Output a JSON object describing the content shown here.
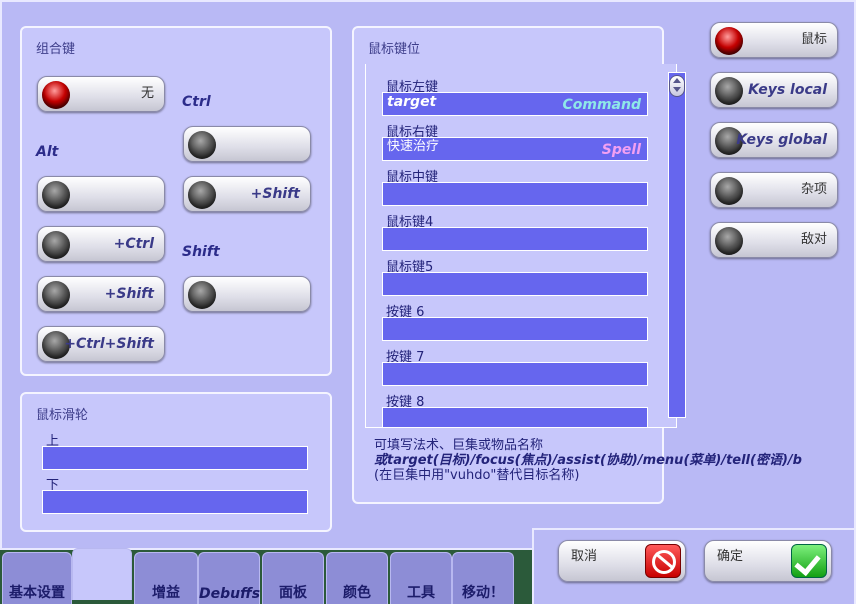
{
  "modifiers": {
    "title": "组合键",
    "group_ctrl": "Ctrl",
    "group_alt": "Alt",
    "group_shift": "Shift",
    "buttons": {
      "none": "无",
      "ctrl": "",
      "alt": "",
      "ctrl_shift": "+Shift",
      "alt_ctrl": "+Ctrl",
      "shift": "",
      "alt_shift": "+Shift",
      "alt_ctrl_shift": "+Ctrl+Shift"
    }
  },
  "wheel": {
    "title": "鼠标滑轮",
    "up_label": "上",
    "up_value": "",
    "down_label": "下",
    "down_value": ""
  },
  "bindings": {
    "title": "鼠标键位",
    "rows": [
      {
        "label": "鼠标左键",
        "value": "target",
        "type": "Command",
        "type_color": "#8ee8e8"
      },
      {
        "label": "鼠标右键",
        "value": "快速治疗",
        "type": "Spell",
        "type_color": "#f2a0f2"
      },
      {
        "label": "鼠标中键",
        "value": "",
        "type": ""
      },
      {
        "label": "鼠标键4",
        "value": "",
        "type": ""
      },
      {
        "label": "鼠标键5",
        "value": "",
        "type": ""
      },
      {
        "label": "按键 6",
        "value": "",
        "type": ""
      },
      {
        "label": "按键 7",
        "value": "",
        "type": ""
      },
      {
        "label": "按键 8",
        "value": "",
        "type": ""
      }
    ],
    "help_line1": "可填写法术、巨集或物品名称",
    "help_line2": "或target(目标)/focus(焦点)/assist(协助)/menu(菜单)/tell(密语)/b",
    "help_line3": "(在巨集中用\"vuhdo\"替代目标名称)"
  },
  "modes": {
    "mouse": "鼠标",
    "keys_local": "Keys local",
    "keys_global": "Keys global",
    "misc": "杂项",
    "hostile": "敌对"
  },
  "actions": {
    "cancel": "取消",
    "ok": "确定"
  },
  "tabs": [
    "基本设置",
    "",
    "增益",
    "Debuffs",
    "面板",
    "颜色",
    "工具",
    "移动！"
  ]
}
